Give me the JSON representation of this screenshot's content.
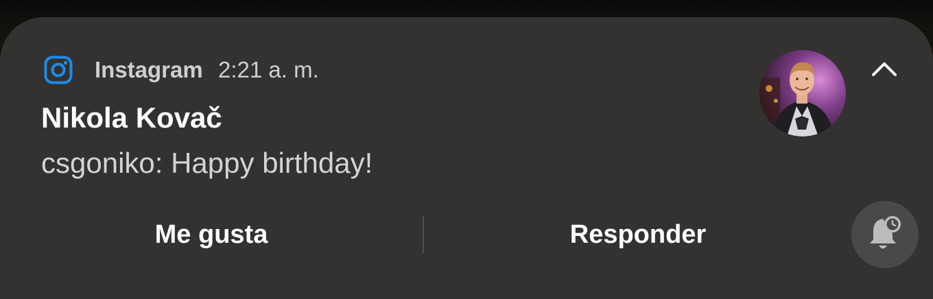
{
  "notification": {
    "app_name": "Instagram",
    "timestamp": "2:21 a. m.",
    "sender": "Nikola Kovač",
    "message": "csgoniko: Happy birthday!",
    "app_icon": "instagram-icon",
    "expand_icon": "chevron-up-icon",
    "snooze_icon": "bell-snooze-icon",
    "actions": [
      {
        "label": "Me gusta"
      },
      {
        "label": "Responder"
      }
    ]
  },
  "colors": {
    "card_background": "#333230",
    "instagram_blue": "#1e8bea",
    "title_text": "#ffffff",
    "secondary_text": "#cfcfcf",
    "snooze_button_background": "#4a4947"
  }
}
